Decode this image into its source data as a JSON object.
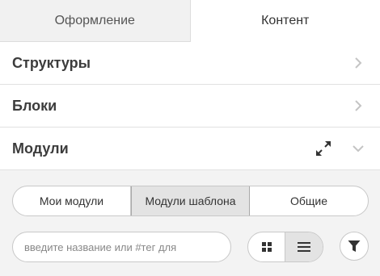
{
  "tabs": [
    {
      "label": "Оформление"
    },
    {
      "label": "Контент"
    }
  ],
  "sections": [
    {
      "title": "Структуры",
      "icon": "chevron-right-icon"
    },
    {
      "title": "Блоки",
      "icon": "chevron-right-icon"
    },
    {
      "title": "Модули",
      "icon": "chevron-down-icon",
      "extra_icon": "expand-icon"
    }
  ],
  "modules_panel": {
    "segments": [
      {
        "label": "Мои модули"
      },
      {
        "label": "Модули шаблона",
        "selected": true
      },
      {
        "label": "Общие"
      }
    ],
    "search": {
      "placeholder": "введите название или #тег для",
      "value": ""
    },
    "view_toggle": {
      "grid_icon": "grid-icon",
      "list_icon": "list-icon",
      "selected": "list"
    },
    "filter_icon": "filter-icon"
  },
  "colors": {
    "inactive_tab_bg": "#f1f1f1",
    "panel_bg": "#f3f3f3",
    "selected_segment_bg": "#e3e3e3",
    "border": "#c8c8c8"
  }
}
